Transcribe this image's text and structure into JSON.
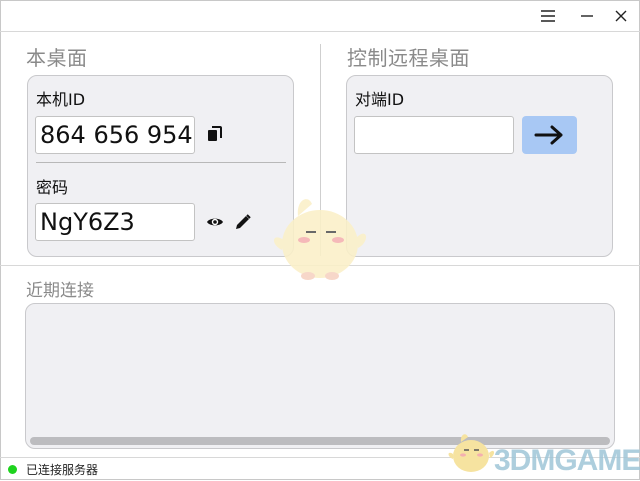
{
  "window": {
    "menu_icon": "hamburger-icon",
    "minimize_icon": "minimize-icon",
    "close_icon": "close-icon"
  },
  "local": {
    "title": "本桌面",
    "id_label": "本机ID",
    "id_value": "864 656 954",
    "copy_icon": "copy-icon",
    "password_label": "密码",
    "password_value": "NgY6Z3",
    "show_icon": "eye-icon",
    "edit_icon": "pencil-icon"
  },
  "remote": {
    "title": "控制远程桌面",
    "peer_id_label": "对端ID",
    "peer_id_value": "",
    "connect_icon": "arrow-right-icon",
    "accent_color": "#a8c8f4"
  },
  "recent": {
    "title": "近期连接",
    "items": []
  },
  "status": {
    "text": "已连接服务器",
    "indicator_color": "#1ed31e"
  },
  "watermark": {
    "text": "3DMGAME"
  }
}
